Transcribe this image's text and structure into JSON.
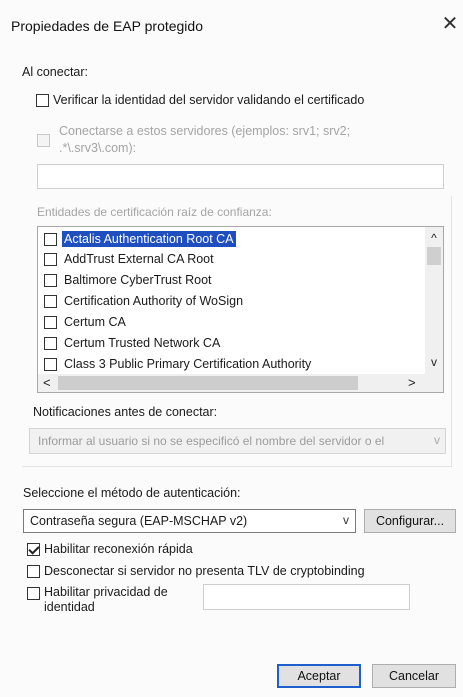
{
  "window": {
    "title": "Propiedades de EAP protegido",
    "close_glyph": "✕"
  },
  "connect": {
    "heading": "Al conectar:",
    "verify_label": "Verificar la identidad del servidor validando el certificado",
    "verify_checked": false,
    "servers_label_line1": "Conectarse a estos servidores (ejemplos: srv1; srv2;",
    "servers_label_line2": ".*\\.srv3\\.com):",
    "servers_value": "",
    "trusted_ca_label": "Entidades de certificación raíz de confianza:",
    "ca_list": [
      {
        "label": "Actalis Authentication Root CA",
        "checked": false,
        "selected": true
      },
      {
        "label": "AddTrust External CA Root",
        "checked": false,
        "selected": false
      },
      {
        "label": "Baltimore CyberTrust Root",
        "checked": false,
        "selected": false
      },
      {
        "label": "Certification Authority of WoSign",
        "checked": false,
        "selected": false
      },
      {
        "label": "Certum CA",
        "checked": false,
        "selected": false
      },
      {
        "label": "Certum Trusted Network CA",
        "checked": false,
        "selected": false
      },
      {
        "label": "Class 3 Public Primary Certification Authority",
        "checked": false,
        "selected": false
      }
    ],
    "scroll_up_glyph": "^",
    "scroll_down_glyph": "v",
    "scroll_left_glyph": "<",
    "scroll_right_glyph": ">",
    "notifications_label": "Notificaciones antes de conectar:",
    "notifications_value": "Informar al usuario si no se especificó el nombre del servidor o el",
    "notifications_caret": "v"
  },
  "auth": {
    "method_label": "Seleccione el método de autenticación:",
    "method_value": "Contraseña segura (EAP-MSCHAP v2)",
    "method_caret": "v",
    "configure_label": "Configurar...",
    "fast_reconnect_label": "Habilitar reconexión rápida",
    "fast_reconnect_checked": true,
    "disconnect_label": "Desconectar si servidor no presenta TLV de cryptobinding",
    "disconnect_checked": false,
    "privacy_label_line1": "Habilitar privacidad de",
    "privacy_label_line2": "identidad",
    "privacy_checked": false,
    "privacy_value": ""
  },
  "footer": {
    "ok_label": "Aceptar",
    "cancel_label": "Cancelar"
  }
}
